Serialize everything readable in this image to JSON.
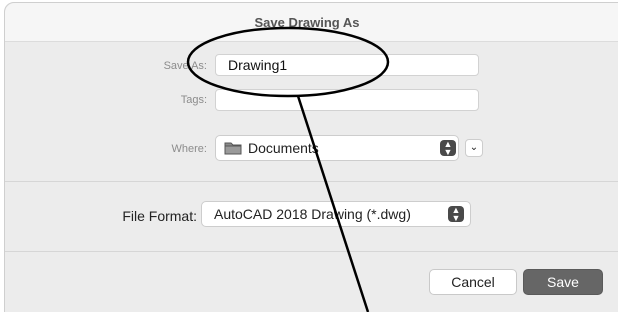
{
  "dialog": {
    "title": "Save Drawing As"
  },
  "fields": {
    "save_as_label": "Save As:",
    "save_as_value": "Drawing1",
    "tags_label": "Tags:",
    "tags_value": "",
    "where_label": "Where:",
    "where_value": "Documents"
  },
  "format": {
    "label": "File Format:",
    "value": "AutoCAD 2018 Drawing (*.dwg)"
  },
  "buttons": {
    "cancel": "Cancel",
    "save": "Save"
  },
  "icons": {
    "folder": "folder-icon",
    "stepper": "stepper-arrows-icon",
    "expand": "chevron-down-icon"
  }
}
